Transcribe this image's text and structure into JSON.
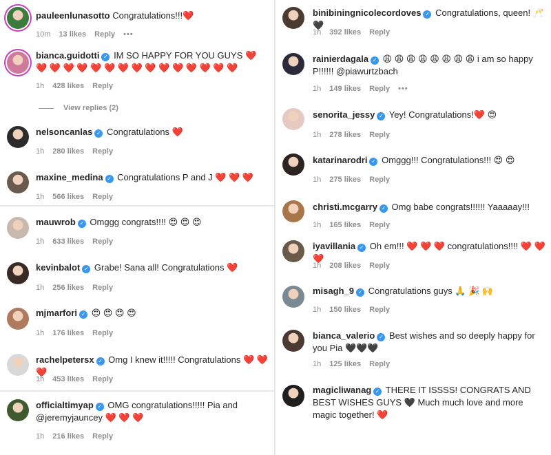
{
  "left_comments": [
    {
      "username": "pauleenlunasotto",
      "verified": false,
      "text": "Congratulations!!!❤️",
      "time": "10m",
      "likes": "13 likes",
      "reply": "Reply",
      "more": "•••",
      "avatar_color": "#3c7a3e",
      "ring": true
    },
    {
      "username": "bianca.guidotti",
      "verified": true,
      "text": "IM SO HAPPY FOR YOU GUYS ❤️ ❤️ ❤️ ❤️ ❤️ ❤️ ❤️ ❤️ ❤️ ❤️ ❤️ ❤️ ❤️ ❤️ ❤️ ❤️",
      "time": "1h",
      "likes": "428 likes",
      "reply": "Reply",
      "avatar_color": "#d07a9b",
      "ring": true
    },
    {
      "username": "nelsoncanlas",
      "verified": true,
      "text": "Congratulations ❤️",
      "time": "1h",
      "likes": "280 likes",
      "reply": "Reply",
      "avatar_color": "#2b2b2b",
      "ring": false
    },
    {
      "username": "maxine_medina",
      "verified": true,
      "text": "Congratulations P and J ❤️ ❤️ ❤️",
      "time": "1h",
      "likes": "566 likes",
      "reply": "Reply",
      "avatar_color": "#6b5b4f",
      "ring": false
    },
    {
      "username": "mauwrob",
      "verified": true,
      "text": "Omggg congrats!!!! 😍 😍 😍",
      "time": "1h",
      "likes": "633 likes",
      "reply": "Reply",
      "avatar_color": "#c9b8ae",
      "ring": false
    },
    {
      "username": "kevinbalot",
      "verified": true,
      "text": "Grabe! Sana all! Congratulations ❤️",
      "time": "1h",
      "likes": "256 likes",
      "reply": "Reply",
      "avatar_color": "#3a2a25",
      "ring": false
    },
    {
      "username": "mjmarfori",
      "verified": true,
      "text": "😍 😍 😍 😍",
      "time": "1h",
      "likes": "176 likes",
      "reply": "Reply",
      "avatar_color": "#b07a5e",
      "ring": false
    },
    {
      "username": "rachelpetersx",
      "verified": true,
      "text": "Omg I knew it!!!!! Congratulations ❤️ ❤️ ❤️",
      "time": "1h",
      "likes": "453 likes",
      "reply": "Reply",
      "avatar_color": "#d8d8d8",
      "ring": false
    },
    {
      "username": "officialtimyap",
      "verified": true,
      "text": "OMG congratulations!!!!! Pia and @jeremyjauncey ❤️ ❤️ ❤️",
      "time": "1h",
      "likes": "216 likes",
      "reply": "Reply",
      "avatar_color": "#3f5a2e",
      "ring": false
    }
  ],
  "view_replies": "View replies (2)",
  "right_comments": [
    {
      "username": "binibiningnicolecordoves",
      "verified": true,
      "text": "Congratulations, queen! 🥂🖤",
      "time": "1h",
      "likes": "392 likes",
      "reply": "Reply",
      "avatar_color": "#4a3a30",
      "ring": false
    },
    {
      "username": "rainierdagala",
      "verified": true,
      "text": "😩 😩 😩 😩 😩 😩 😩 😩 i am so happy P!!!!!! @piawurtzbach",
      "time": "1h",
      "likes": "149 likes",
      "reply": "Reply",
      "more": "•••",
      "avatar_color": "#2a2a3a",
      "ring": false
    },
    {
      "username": "senorita_jessy",
      "verified": true,
      "text": "Yey! Congratulations!❤️ 😍",
      "time": "1h",
      "likes": "278 likes",
      "reply": "Reply",
      "avatar_color": "#e6c9c0",
      "ring": false
    },
    {
      "username": "katarinarodri",
      "verified": true,
      "text": "Omggg!!! Congratulations!!! 😍 😍",
      "time": "1h",
      "likes": "275 likes",
      "reply": "Reply",
      "avatar_color": "#2c2420",
      "ring": false
    },
    {
      "username": "christi.mcgarry",
      "verified": true,
      "text": "Omg babe congrats!!!!!! Yaaaaay!!!",
      "time": "1h",
      "likes": "165 likes",
      "reply": "Reply",
      "avatar_color": "#a9764a",
      "ring": false
    },
    {
      "username": "iyavillania",
      "verified": true,
      "text": "Oh em!!! ❤️ ❤️ ❤️ congratulations!!!! ❤️ ❤️ ❤️",
      "time": "1h",
      "likes": "208 likes",
      "reply": "Reply",
      "avatar_color": "#6a5a48",
      "ring": false
    },
    {
      "username": "misagh_9",
      "verified": true,
      "text": "Congratulations guys 🙏 🎉 🙌",
      "time": "1h",
      "likes": "150 likes",
      "reply": "Reply",
      "avatar_color": "#7a8a94",
      "ring": false
    },
    {
      "username": "bianca_valerio",
      "verified": true,
      "text": "Best wishes and so deeply happy for you Pia 🖤🖤🖤",
      "time": "1h",
      "likes": "125 likes",
      "reply": "Reply",
      "avatar_color": "#4b3a32",
      "ring": false
    },
    {
      "username": "magicliwanag",
      "verified": true,
      "text": "THERE IT ISSSS! CONGRATS AND BEST WISHES GUYS 🖤 Much much love and more magic together! ❤️",
      "time": "",
      "likes": "",
      "reply": "",
      "avatar_color": "#1f1f1f",
      "ring": false
    }
  ],
  "colors": {
    "verified": "#3897f0",
    "meta": "#8e8e8e",
    "heart": "#ed4956"
  }
}
